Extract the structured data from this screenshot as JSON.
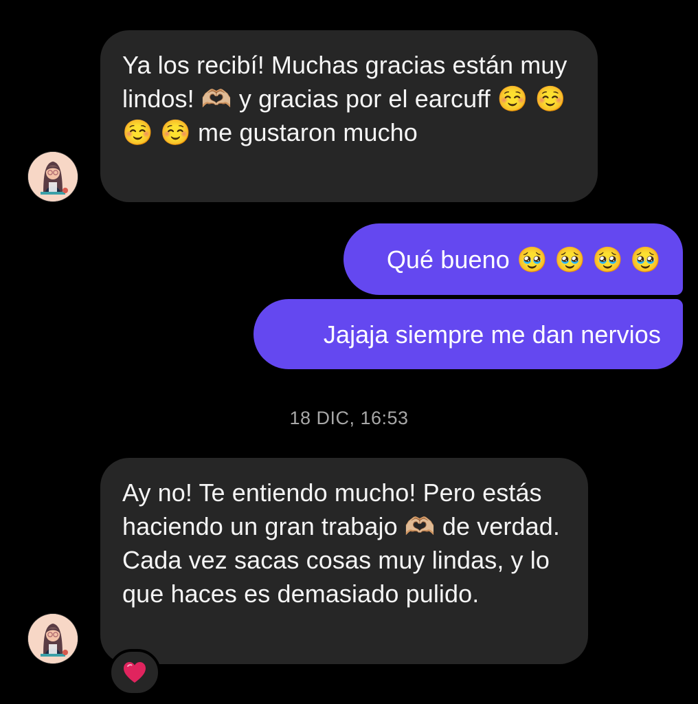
{
  "messages": [
    {
      "sender": "them",
      "text": "Ya los recibí! Muchas gracias están muy lindos! 🫶🏼 y gracias por el earcuff ☺️ ☺️ ☺️ ☺️ me gustaron mucho"
    },
    {
      "sender": "me",
      "text": "Qué bueno 🥹 🥹 🥹 🥹"
    },
    {
      "sender": "me",
      "text": "Jajaja siempre me dan nervios"
    },
    {
      "sender": "them",
      "text": "Ay no! Te entiendo mucho! Pero estás haciendo un gran trabajo 🫶🏼 de verdad. Cada vez sacas cosas muy lindas, y lo que haces es demasiado pulido."
    }
  ],
  "timestamp": "18 DIC, 16:53",
  "reaction": {
    "icon": "red-heart-icon",
    "emoji": "❤️"
  },
  "colors": {
    "background": "#000000",
    "incoming_bubble": "#262626",
    "outgoing_bubble": "#6448f0",
    "timestamp_text": "#a8a8a8",
    "heart": "#e0245e",
    "avatar_bg": "#f7d7c6"
  }
}
